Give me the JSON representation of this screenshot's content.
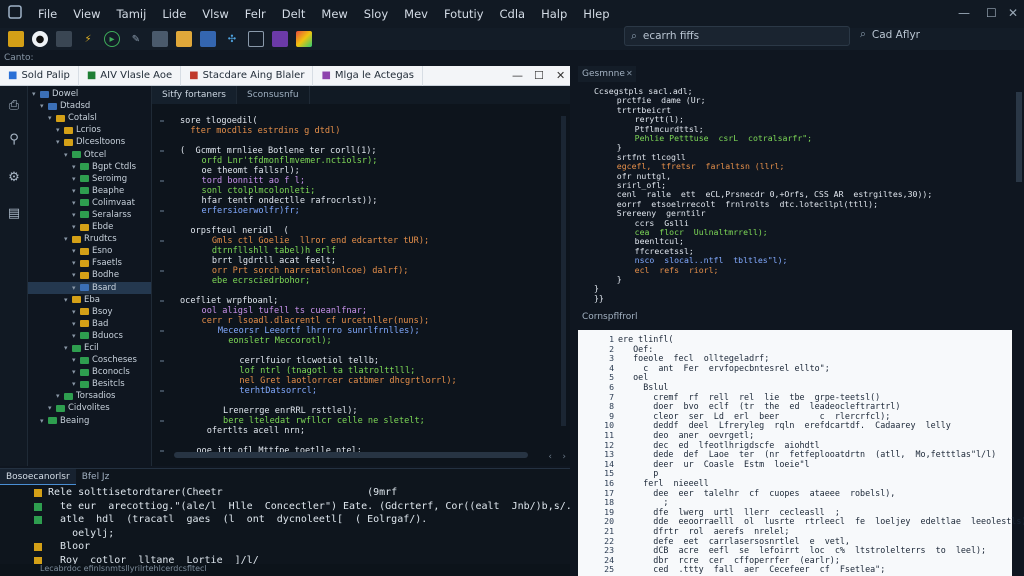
{
  "menu": [
    "File",
    "View",
    "Tamij",
    "Lide",
    "Vlsw",
    "Felr",
    "Delt",
    "Mew",
    "Sloy",
    "Mev",
    "Fotutiy",
    "Cdla",
    "Halp",
    "Hlep"
  ],
  "search": {
    "value": "ecarrh fiffs",
    "label2": "Cad Aflyr"
  },
  "path": "Canto:",
  "file_tabs": [
    {
      "label": "Sold Palip",
      "color": "#2a6fd6"
    },
    {
      "label": "AIV Vlasle Aoe",
      "color": "#1e7e34"
    },
    {
      "label": "Stacdare Aing Blaler",
      "color": "#c0392b"
    },
    {
      "label": "Mlga le Actegas",
      "color": "#8e44ad"
    }
  ],
  "editor_tabs": [
    "Sitfy fortaners",
    "Sconsusnfu"
  ],
  "tree": [
    {
      "label": "Dowel",
      "depth": 0,
      "color": "#3b6fb6"
    },
    {
      "label": "Dtadsd",
      "depth": 1,
      "color": "#3b6fb6"
    },
    {
      "label": "Cotalsl",
      "depth": 2,
      "color": "#d4a017"
    },
    {
      "label": "Lcrios",
      "depth": 3,
      "color": "#d4a017"
    },
    {
      "label": "Dlcesltoons",
      "depth": 3,
      "color": "#d4a017"
    },
    {
      "label": "Otcel",
      "depth": 4,
      "color": "#2e9e4f"
    },
    {
      "label": "Bgpt Ctdls",
      "depth": 5,
      "color": "#2e9e4f"
    },
    {
      "label": "Seroimg",
      "depth": 5,
      "color": "#2e9e4f"
    },
    {
      "label": "Beaphe",
      "depth": 5,
      "color": "#2e9e4f"
    },
    {
      "label": "Colimvaat",
      "depth": 5,
      "color": "#2e9e4f"
    },
    {
      "label": "Seralarss",
      "depth": 5,
      "color": "#2e9e4f"
    },
    {
      "label": "Ebde",
      "depth": 5,
      "color": "#d4a017"
    },
    {
      "label": "Rrudtcs",
      "depth": 4,
      "color": "#d4a017"
    },
    {
      "label": "Esno",
      "depth": 5,
      "color": "#d4a017"
    },
    {
      "label": "Fsaetls",
      "depth": 5,
      "color": "#d4a017"
    },
    {
      "label": "Bodhe",
      "depth": 5,
      "color": "#d4a017"
    },
    {
      "label": "Bsard",
      "depth": 5,
      "color": "#3b6fb6",
      "selected": true
    },
    {
      "label": "Eba",
      "depth": 4,
      "color": "#d4a017"
    },
    {
      "label": "Bsoy",
      "depth": 5,
      "color": "#d4a017"
    },
    {
      "label": "Bad",
      "depth": 5,
      "color": "#d4a017"
    },
    {
      "label": "Bduocs",
      "depth": 5,
      "color": "#2e9e4f"
    },
    {
      "label": "Ecil",
      "depth": 4,
      "color": "#2e9e4f"
    },
    {
      "label": "Coscheses",
      "depth": 5,
      "color": "#2e9e4f"
    },
    {
      "label": "Bconocls",
      "depth": 5,
      "color": "#2e9e4f"
    },
    {
      "label": "Besitcls",
      "depth": 5,
      "color": "#2e9e4f"
    },
    {
      "label": "Torsadios",
      "depth": 3,
      "color": "#2e9e4f"
    },
    {
      "label": "Cidvolites",
      "depth": 2,
      "color": "#2e9e4f"
    },
    {
      "label": "Beaing",
      "depth": 1,
      "color": "#2e9e4f"
    }
  ],
  "editor_lines": [
    {
      "t": "sore tlogoedil(",
      "c": "#e0e6ee",
      "i": 0
    },
    {
      "t": "  fter mocdlis estrdins g dtdl)",
      "c": "#e58f4a",
      "i": 0
    },
    {
      "t": "",
      "c": "#e0e6ee",
      "i": 0
    },
    {
      "t": "(  Gcmmt mrnliee Botlene ter corll(1);",
      "c": "#e0e6ee",
      "i": 0
    },
    {
      "t": "   orfd Lnr'tfdmonflmvemer.nctiolsr);",
      "c": "#7ed957",
      "i": 1
    },
    {
      "t": "   oe theomt fallsrl);",
      "c": "#e0e6ee",
      "i": 1
    },
    {
      "t": "   tord bonnitt ao f l;",
      "c": "#c792ea",
      "i": 1
    },
    {
      "t": "   sonl ctolplmcolonleti;",
      "c": "#7ed957",
      "i": 1
    },
    {
      "t": "   hfar tentf ondectlle rafrocrlst));",
      "c": "#e0e6ee",
      "i": 1
    },
    {
      "t": "   erfersioerwolfr)fr;",
      "c": "#82aaff",
      "i": 1
    },
    {
      "t": "",
      "c": "#e0e6ee",
      "i": 0
    },
    {
      "t": "  orpsfteul neridl  (",
      "c": "#e0e6ee",
      "i": 0
    },
    {
      "t": "     Gmls ctl Goelie  llror end edcartter tUR);",
      "c": "#e58f4a",
      "i": 1
    },
    {
      "t": "     dtrnfllshll tabel)h erlf",
      "c": "#7ed957",
      "i": 1
    },
    {
      "t": "     brrt lgdrtll acat feelt;",
      "c": "#e0e6ee",
      "i": 1
    },
    {
      "t": "     orr Prt sorch narretatlonlcoe) dalrf);",
      "c": "#e58f4a",
      "i": 1
    },
    {
      "t": "     ebe ecrsciedrbohor;",
      "c": "#7ed957",
      "i": 1
    },
    {
      "t": "",
      "c": "#e0e6ee",
      "i": 0
    },
    {
      "t": "ocefliet wrpfboanl;",
      "c": "#e0e6ee",
      "i": 0
    },
    {
      "t": "   ool aligsl tufell ts cueanlfnar;",
      "c": "#c792ea",
      "i": 1
    },
    {
      "t": "   cerr r lsoadl.dlacrentl cf urcetnller(nuns);",
      "c": "#e58f4a",
      "i": 1
    },
    {
      "t": "     Meceorsr Leeortf lhrrrro sunrlfrnlles);",
      "c": "#82aaff",
      "i": 2
    },
    {
      "t": "       eonsletr Meccorotl);",
      "c": "#7ed957",
      "i": 2
    },
    {
      "t": "",
      "c": "#e0e6ee",
      "i": 0
    },
    {
      "t": "        cerrlfuior tlcwotiol tellb;",
      "c": "#e0e6ee",
      "i": 3
    },
    {
      "t": "        lof ntrl (tnagotl ta tlatrolttlll;",
      "c": "#7ed957",
      "i": 3
    },
    {
      "t": "        nel Gret laotlorrcer catbmer dhcgrtlorrl);",
      "c": "#e58f4a",
      "i": 3
    },
    {
      "t": "        terhtDatsorrcl;",
      "c": "#82aaff",
      "i": 3
    },
    {
      "t": "",
      "c": "#e0e6ee",
      "i": 0
    },
    {
      "t": "      Lrenerrge enrRRL rsttlel);",
      "c": "#e0e6ee",
      "i": 2
    },
    {
      "t": "      bere lteledat rwfllcr celle ne sletelt;",
      "c": "#7ed957",
      "i": 2
    },
    {
      "t": "    ofertlts acell nrn;",
      "c": "#e0e6ee",
      "i": 1
    },
    {
      "t": "",
      "c": "#e0e6ee",
      "i": 0
    },
    {
      "t": "  ooe itt ofl Mttfpe toetlle ntel;",
      "c": "#e0e6ee",
      "i": 1
    }
  ],
  "rtop_header": "Gesmnne",
  "rtop_lines": [
    {
      "t": "Ccsegstpls sacl.adl;",
      "c": "#e0e6ee",
      "i": 0
    },
    {
      "t": "   prctfie  dame (Ur;",
      "c": "#e0e6ee",
      "i": 1
    },
    {
      "t": "   trtrtbeicrt",
      "c": "#e0e6ee",
      "i": 1
    },
    {
      "t": "     rerytt(l);",
      "c": "#e0e6ee",
      "i": 2
    },
    {
      "t": "     Ptflmcurdttsl;",
      "c": "#e0e6ee",
      "i": 2
    },
    {
      "t": "     Pehlie Petttuse  csrL  cotralsarfr\";",
      "c": "#7ed957",
      "i": 2
    },
    {
      "t": "   }",
      "c": "#e0e6ee",
      "i": 1
    },
    {
      "t": "   srtfnt tlcogll",
      "c": "#e0e6ee",
      "i": 1
    },
    {
      "t": "   egcefl,  tfretsr  farlaltsn (llrl;",
      "c": "#e58f4a",
      "i": 1
    },
    {
      "t": "   ofr nuttgl,",
      "c": "#e0e6ee",
      "i": 1
    },
    {
      "t": "   srirl_ofl;",
      "c": "#e0e6ee",
      "i": 1
    },
    {
      "t": "   cenl  ralle  ett  eCL,Prsnecdr 0,+Orfs, CSS AR  estrgiltes,30));",
      "c": "#e0e6ee",
      "i": 1
    },
    {
      "t": "   eorrf  etsoelrrecolt  frnlrolts  dtc.lotecllpl(ttll);",
      "c": "#e0e6ee",
      "i": 1
    },
    {
      "t": "   Srereeny  gerntilr",
      "c": "#e0e6ee",
      "i": 1
    },
    {
      "t": "     ccrs  Gslli",
      "c": "#e0e6ee",
      "i": 2
    },
    {
      "t": "     cea  flocr  Uulnaltmrrell);",
      "c": "#7ed957",
      "i": 2
    },
    {
      "t": "     beenltcul;",
      "c": "#e0e6ee",
      "i": 2
    },
    {
      "t": "     ffcrecetssl;",
      "c": "#e0e6ee",
      "i": 2
    },
    {
      "t": "     nsco  slocal..ntfl  tbltles\"l);",
      "c": "#82aaff",
      "i": 2
    },
    {
      "t": "     ecl  refs  riorl;",
      "c": "#e58f4a",
      "i": 2
    },
    {
      "t": "   }",
      "c": "#e0e6ee",
      "i": 1
    },
    {
      "t": "}",
      "c": "#e0e6ee",
      "i": 0
    },
    {
      "t": "}}",
      "c": "#e0e6ee",
      "i": 0
    }
  ],
  "rbot_header": "Cornspflfrorl",
  "rbot_lines": [
    {
      "n": "1",
      "t": "ere tlinfl(",
      "c": "#1b2737"
    },
    {
      "n": "2",
      "t": "   Oef:",
      "c": "#1b2737"
    },
    {
      "n": "3",
      "t": "   foeole  fecl  olltegeladrf;",
      "c": "#1b2737"
    },
    {
      "n": "4",
      "t": "     c  ant  Fer  ervfopecbntesrel ellto\";",
      "c": "#1b2737"
    },
    {
      "n": "5",
      "t": "   oel",
      "c": "#1b2737"
    },
    {
      "n": "6",
      "t": "     Bslul",
      "c": "#1b2737"
    },
    {
      "n": "7",
      "t": "       cremf  rf  rell  rel  lie  tbe  grpe-teetsl()",
      "c": "#1b2737"
    },
    {
      "n": "8",
      "t": "       doer  bvo  eclf  (tr  the  ed  leadeocleftrartrl)",
      "c": "#1b2737"
    },
    {
      "n": "9",
      "t": "       cleor  ser  Ld  erl  beer        c  rlercrfcl);",
      "c": "#1b2737"
    },
    {
      "n": "10",
      "t": "       deddf  deel  Lfreryleg  rqln  erefdcartdf.  Cadaarey  lelly",
      "c": "#1b2737"
    },
    {
      "n": "11",
      "t": "       deo  aner  oevrgetl;",
      "c": "#1b2737"
    },
    {
      "n": "12",
      "t": "       dec  ed  lfeotlhrigdscfe  aiohdtl",
      "c": "#1b2737"
    },
    {
      "n": "13",
      "t": "       dede  def  Laoe  ter  (nr  fetfeplooatdrtn  (atll,  Mo,fetttlas\"l/l)",
      "c": "#1b2737"
    },
    {
      "n": "14",
      "t": "       deer  ur  Coasle  Estm  loeie\"l",
      "c": "#1b2737"
    },
    {
      "n": "15",
      "t": "       p",
      "c": "#1b2737"
    },
    {
      "n": "16",
      "t": "     ferl  nieeell",
      "c": "#1b2737"
    },
    {
      "n": "17",
      "t": "       dee  eer  talelhr  cf  cuopes  ataeee  robelsl),",
      "c": "#1b2737"
    },
    {
      "n": "18",
      "t": "         ;",
      "c": "#1b2737"
    },
    {
      "n": "19",
      "t": "       dfe  lwerg  urtl  llerr  cecleasll  ;",
      "c": "#1b2737"
    },
    {
      "n": "20",
      "t": "       dde  eeoorraelll  ol  lusrte  rtrleecl  fe  loeljey  edeltlae  leeolestls);",
      "c": "#1b2737"
    },
    {
      "n": "21",
      "t": "       dfrtr  rol  aerefs  nrelel;",
      "c": "#1b2737"
    },
    {
      "n": "22",
      "t": "       defe  eet  carrlasersosnrtlel  e  vetl,",
      "c": "#1b2737"
    },
    {
      "n": "23",
      "t": "       dCB  acre  eefl  se  lefoirrt  loc  c%  ltstrolelterrs  to  leel);",
      "c": "#1b2737"
    },
    {
      "n": "24",
      "t": "       dbr  rcre  cer  cffoperrfer  (earlr);",
      "c": "#1b2737"
    },
    {
      "n": "25",
      "t": "       ced  .ttty  fall  aer  Cecefeer  cf  Fsetlea\";",
      "c": "#1b2737"
    }
  ],
  "bottom_tabs": [
    "Bosoecanorlsr",
    "Bfel Jz"
  ],
  "bottom_lines": [
    {
      "t": "Rele solttisetordtarer(Cheetr                        (9mrf",
      "c": "#dfe7ee",
      "mark": "#d4a017"
    },
    {
      "t": "  te eur  arecottiog.\"(ale/l  Hlle  Concectler\") Eate. (Gdcrterf, Cor((ealt  Jnb/)b,s/.",
      "c": "#dfe7ee",
      "mark": "#2e9e4f"
    },
    {
      "t": "  atle  hdl  (tracatl  gaes  (l  ont  dycnoleetl[  ( Eolrgaf/).",
      "c": "#dfe7ee",
      "mark": "#2e9e4f"
    },
    {
      "t": "    oelylj;",
      "c": "#dfe7ee",
      "mark": ""
    },
    {
      "t": "  Bloor",
      "c": "#dfe7ee",
      "mark": "#d4a017"
    },
    {
      "t": "  Roy  cotlor  lltane  Lortie  ]/l/",
      "c": "#dfe7ee",
      "mark": "#d4a017"
    }
  ],
  "status": "Lecabrdoc  efinlsnmtsllyrilrtehlcerdcsfltecl"
}
